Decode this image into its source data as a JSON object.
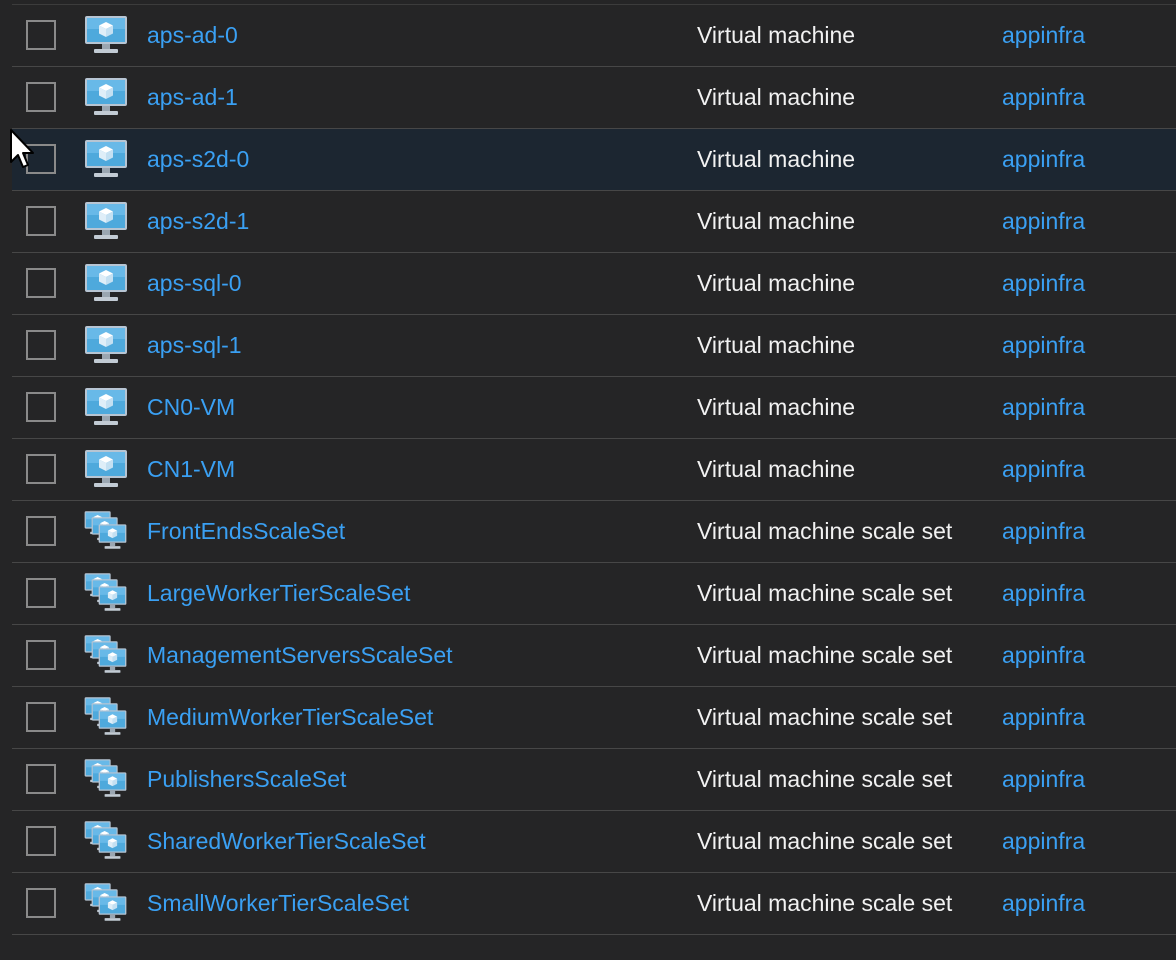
{
  "colors": {
    "background": "#252526",
    "link": "#3aa0f3",
    "text": "#f2f2f2",
    "row_divider": "#474747",
    "hover_row": "#1c2631",
    "checkbox_border": "#8a8a8a"
  },
  "hover_row_index": 2,
  "resources": [
    {
      "name": "aps-ad-0",
      "type": "Virtual machine",
      "resource_group": "appinfra",
      "icon": "virtual-machine-icon"
    },
    {
      "name": "aps-ad-1",
      "type": "Virtual machine",
      "resource_group": "appinfra",
      "icon": "virtual-machine-icon"
    },
    {
      "name": "aps-s2d-0",
      "type": "Virtual machine",
      "resource_group": "appinfra",
      "icon": "virtual-machine-icon"
    },
    {
      "name": "aps-s2d-1",
      "type": "Virtual machine",
      "resource_group": "appinfra",
      "icon": "virtual-machine-icon"
    },
    {
      "name": "aps-sql-0",
      "type": "Virtual machine",
      "resource_group": "appinfra",
      "icon": "virtual-machine-icon"
    },
    {
      "name": "aps-sql-1",
      "type": "Virtual machine",
      "resource_group": "appinfra",
      "icon": "virtual-machine-icon"
    },
    {
      "name": "CN0-VM",
      "type": "Virtual machine",
      "resource_group": "appinfra",
      "icon": "virtual-machine-icon"
    },
    {
      "name": "CN1-VM",
      "type": "Virtual machine",
      "resource_group": "appinfra",
      "icon": "virtual-machine-icon"
    },
    {
      "name": "FrontEndsScaleSet",
      "type": "Virtual machine scale set",
      "resource_group": "appinfra",
      "icon": "vm-scale-set-icon"
    },
    {
      "name": "LargeWorkerTierScaleSet",
      "type": "Virtual machine scale set",
      "resource_group": "appinfra",
      "icon": "vm-scale-set-icon"
    },
    {
      "name": "ManagementServersScaleSet",
      "type": "Virtual machine scale set",
      "resource_group": "appinfra",
      "icon": "vm-scale-set-icon"
    },
    {
      "name": "MediumWorkerTierScaleSet",
      "type": "Virtual machine scale set",
      "resource_group": "appinfra",
      "icon": "vm-scale-set-icon"
    },
    {
      "name": "PublishersScaleSet",
      "type": "Virtual machine scale set",
      "resource_group": "appinfra",
      "icon": "vm-scale-set-icon"
    },
    {
      "name": "SharedWorkerTierScaleSet",
      "type": "Virtual machine scale set",
      "resource_group": "appinfra",
      "icon": "vm-scale-set-icon"
    },
    {
      "name": "SmallWorkerTierScaleSet",
      "type": "Virtual machine scale set",
      "resource_group": "appinfra",
      "icon": "vm-scale-set-icon"
    }
  ]
}
